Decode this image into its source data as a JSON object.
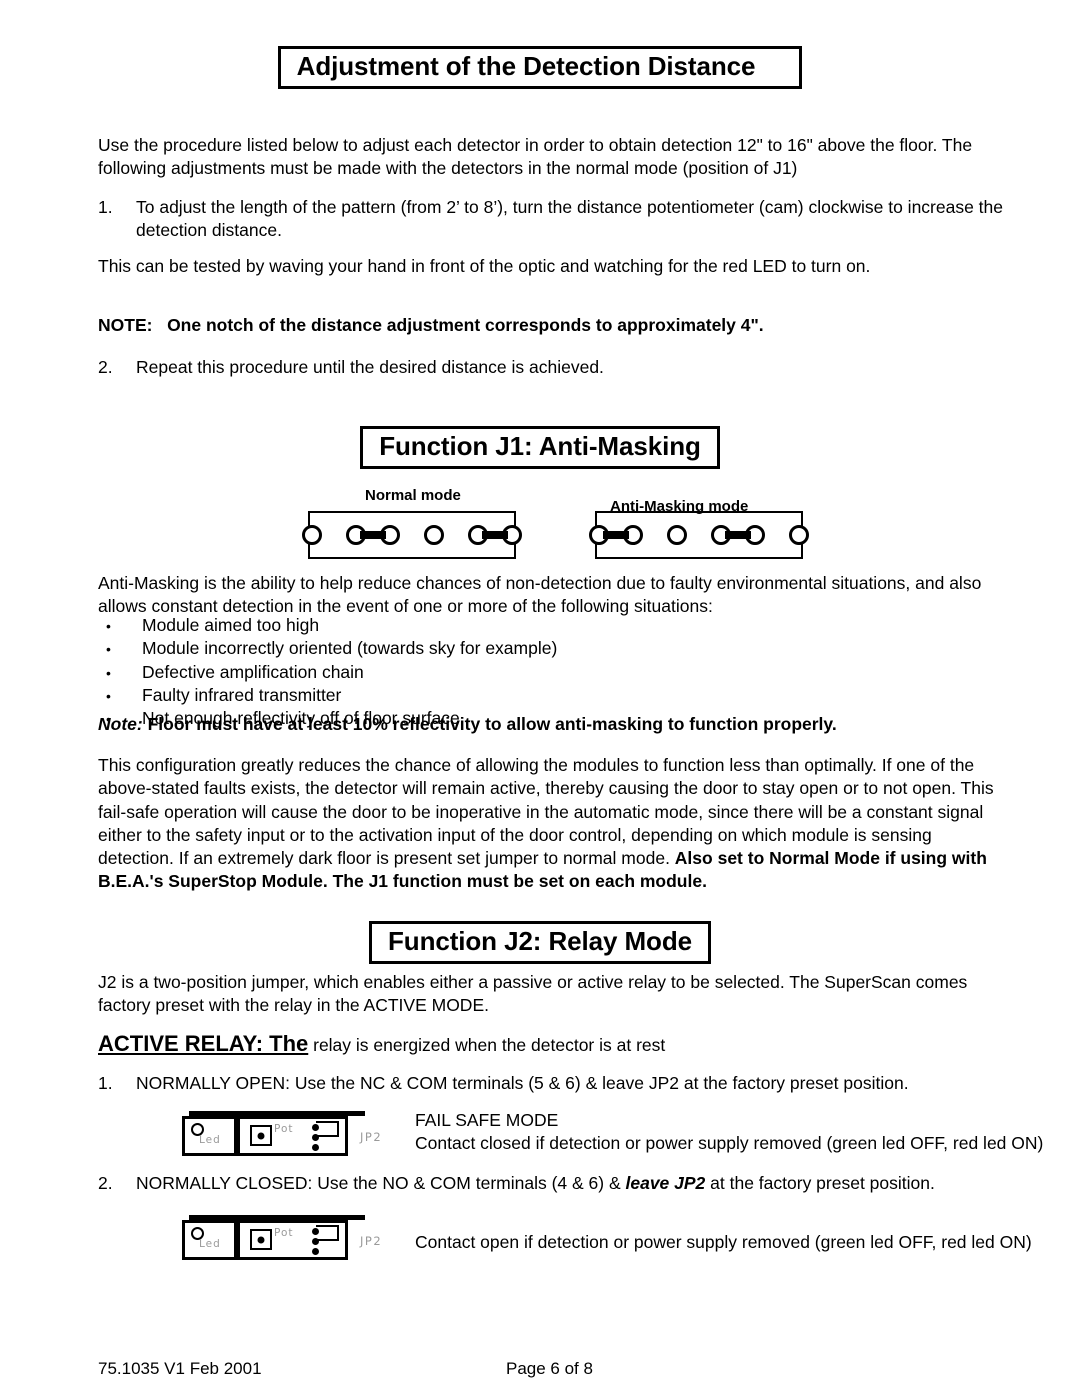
{
  "document": {
    "section1": {
      "heading": "Adjustment of the Detection Distance",
      "intro": "Use the procedure listed below to adjust each detector in order to obtain detection 12\" to 16\" above the floor.  The following adjustments must be made with the detectors in the normal mode (position of J1)",
      "step1_num": "1.",
      "step1_text": "To adjust the length of the pattern (from 2’ to 8’), turn the distance potentiometer (cam) clockwise to increase the detection distance.",
      "step1_sub": "This can be tested by waving your hand in front of the optic and watching for the red LED to turn on.",
      "note_label": "NOTE:",
      "note_text": "One notch of the distance adjustment corresponds to approximately 4\".",
      "step2_num": "2.",
      "step2_text": "Repeat this procedure until the desired distance is achieved."
    },
    "section2": {
      "heading": "Function J1: Anti-Masking",
      "diagram_normal_label": "Normal mode",
      "diagram_anti_label": "Anti-Masking  mode",
      "jumper_normal_pattern": [
        "open",
        "bridged",
        "open",
        "bridged"
      ],
      "jumper_anti_pattern": [
        "bridged",
        "open",
        "bridged",
        "open"
      ],
      "intro": "Anti-Masking is the ability to help reduce chances of non-detection due to faulty environmental situations, and also allows constant detection in the event of one or more of the following situations:",
      "bullets": [
        "Module aimed too high",
        "Module incorrectly oriented (towards sky for example)",
        "Defective amplification chain",
        "Faulty infrared transmitter",
        "Not enough reflectivity off of floor surface"
      ],
      "bullet_glyph": "•",
      "note_label": "Note:",
      "note_text": "Floor must have at least 10% reflectivity to allow anti-masking to function properly.",
      "para_plain": "This configuration greatly reduces the chance of allowing the modules to function less than optimally.  If one of the above-stated faults exists, the detector will remain active, thereby causing the door to stay open or to not open.  This fail-safe operation will cause the door to be inoperative in the automatic mode, since there will be a constant signal either to the safety input or to the activation input of the door control, depending on which module is sensing detection.  If an extremely dark floor is present set jumper to normal mode.  ",
      "para_bold": "Also set to Normal Mode if using with B.E.A.'s SuperStop Module.  The J1 function must be set on each module."
    },
    "section3": {
      "heading": "Function J2:  Relay Mode",
      "intro": "J2 is a two-position jumper, which enables either a passive or active relay to be selected.  The SuperScan comes factory preset with the relay in the ACTIVE MODE.",
      "active_relay_lead": "ACTIVE RELAY: The",
      "active_relay_rest": " relay is energized when the detector is at rest",
      "item1_num": "1.",
      "item1_text": "NORMALLY OPEN: Use the NC & COM terminals (5 & 6) & leave JP2 at the factory preset position.",
      "fail_safe_title": "FAIL SAFE MODE",
      "fail_safe_text": "Contact closed if detection or power supply removed (green led OFF, red led ON)",
      "item2_num": "2.",
      "item2_text_pre": "NORMALLY CLOSED: Use the NO & COM terminals (4 & 6) & ",
      "item2_text_bold": "leave JP2",
      "item2_text_post": " at the factory preset position.",
      "contact_open_text": "Contact open if detection or power supply removed   (green led OFF, red led ON)",
      "pcb": {
        "led_label": "Led",
        "pot_label": "Pot",
        "jp2_label": "JP2"
      }
    },
    "footer": {
      "left": "75.1035 V1  Feb 2001",
      "center": "Page 6 of 8"
    }
  }
}
